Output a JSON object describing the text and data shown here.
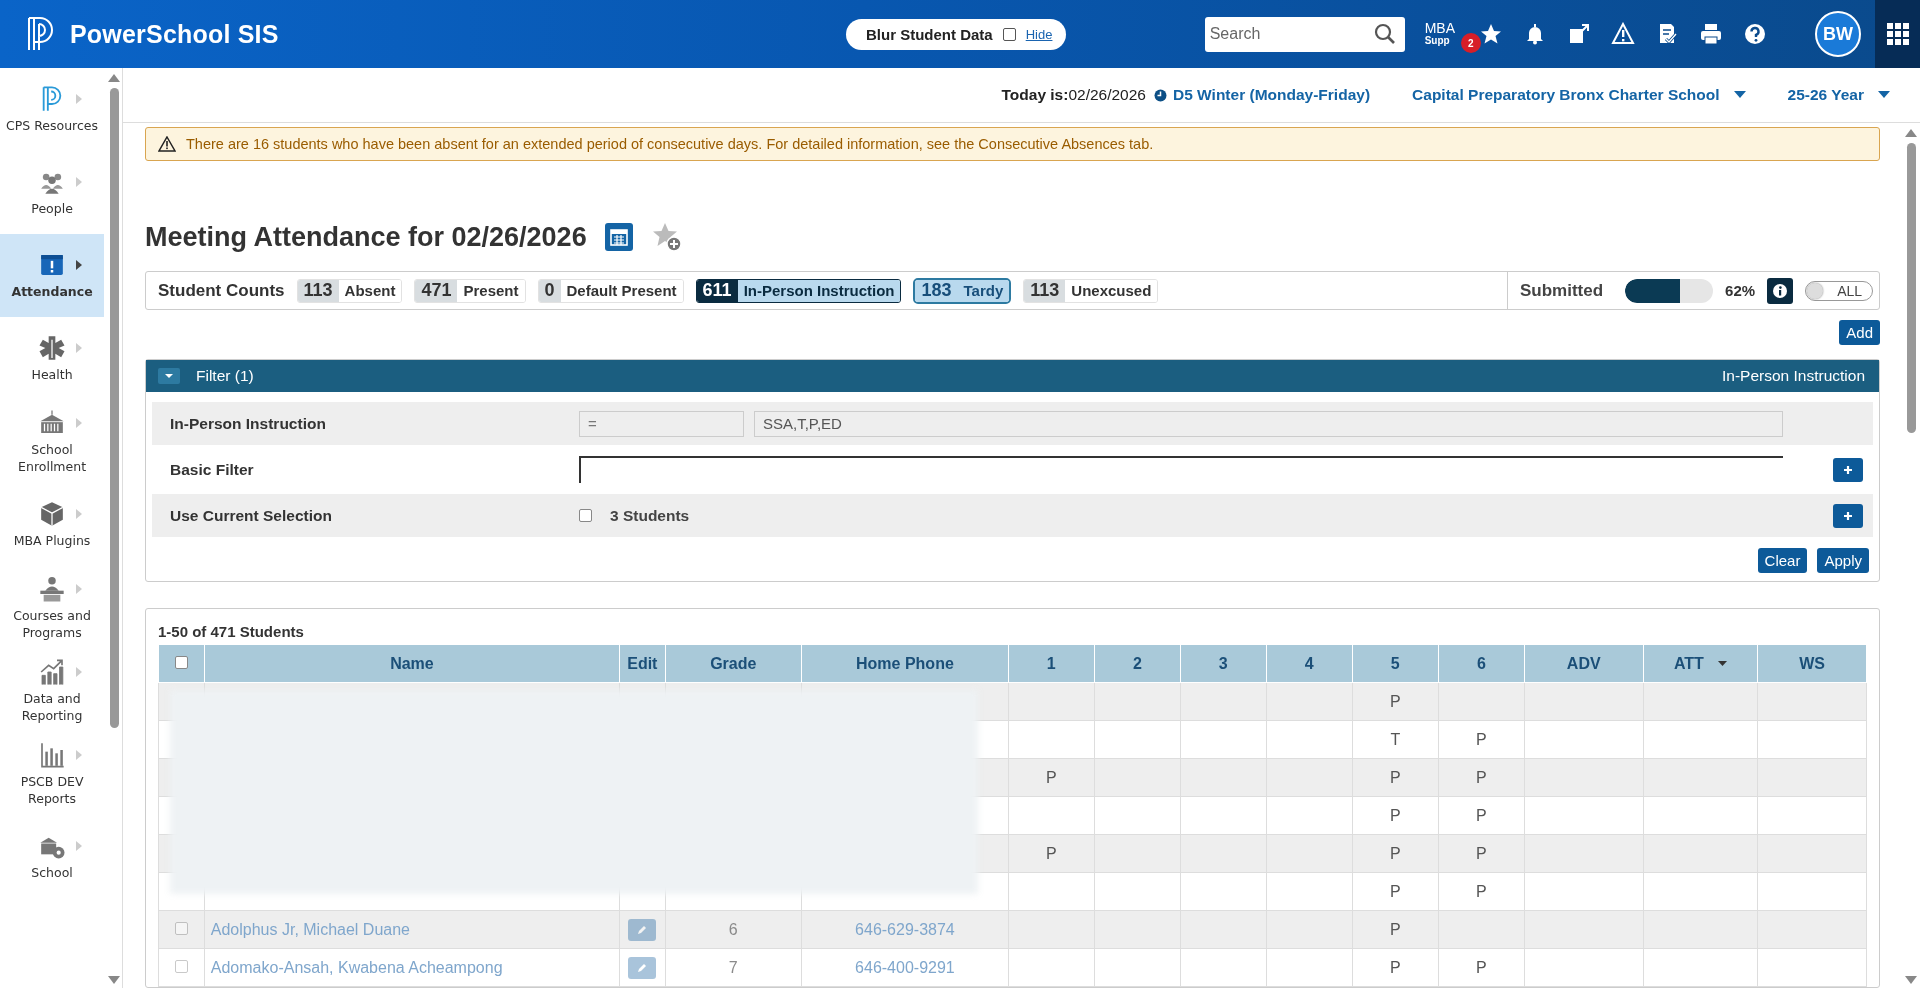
{
  "app": {
    "title": "PowerSchool SIS",
    "blur_label": "Blur Student Data",
    "blur_checked": false,
    "hide_link": "Hide",
    "search_placeholder": "Search",
    "mba_label": "MBA",
    "mba_sub": "Supp",
    "mba_badge": "2",
    "avatar": "BW"
  },
  "sidebar": {
    "items": [
      {
        "label": "CPS Resources",
        "selected": false
      },
      {
        "label": "People",
        "selected": false
      },
      {
        "label": "Attendance",
        "selected": true
      },
      {
        "label": "Health",
        "selected": false
      },
      {
        "label": "School Enrollment",
        "selected": false
      },
      {
        "label": "MBA Plugins",
        "selected": false
      },
      {
        "label": "Courses and Programs",
        "selected": false
      },
      {
        "label": "Data and Reporting",
        "selected": false
      },
      {
        "label": "PSCB DEV Reports",
        "selected": false
      },
      {
        "label": "School",
        "selected": false
      }
    ]
  },
  "info_bar": {
    "today_label": "Today is:",
    "today": "02/26/2026",
    "term": "D5 Winter (Monday-Friday)",
    "school": "Capital Preparatory Bronx Charter School",
    "year": "25-26 Year"
  },
  "alert": "There are 16 students who have been absent for an extended period of consecutive days. For detailed information, see the Consecutive Absences tab.",
  "page_title": "Meeting Attendance for 02/26/2026",
  "counts": {
    "label": "Student Counts",
    "items": [
      {
        "count": "113",
        "label": "Absent",
        "kind": "plain"
      },
      {
        "count": "471",
        "label": "Present",
        "kind": "plain"
      },
      {
        "count": "0",
        "label": "Default Present",
        "kind": "plain"
      },
      {
        "count": "611",
        "label": "In-Person Instruction",
        "kind": "active"
      },
      {
        "count": "183",
        "label": "Tardy",
        "kind": "outlined"
      },
      {
        "count": "113",
        "label": "Unexcused",
        "kind": "plain"
      }
    ],
    "submitted_label": "Submitted",
    "level": 0.62,
    "reading": "62%",
    "toggle_label": "ALL",
    "toggle_on": false
  },
  "add_button": "Add",
  "filter": {
    "title": "Filter (1)",
    "right_label": "In-Person Instruction",
    "expanded": true,
    "rows": [
      {
        "kind": "criteria",
        "label": "In-Person Instruction",
        "operator": "=",
        "value": "SSA,T,P,ED"
      },
      {
        "kind": "text",
        "label": "Basic Filter"
      },
      {
        "kind": "selection",
        "label": "Use Current Selection",
        "checked": false,
        "text": "3 Students"
      }
    ],
    "buttons": [
      "Clear",
      "Apply"
    ]
  },
  "table": {
    "summary": "1-50 of 471 Students",
    "header_checked": false,
    "columns": [
      {
        "label": "Name",
        "sorted": false
      },
      {
        "label": "Edit",
        "sorted": false
      },
      {
        "label": "Grade",
        "sorted": false
      },
      {
        "label": "Home Phone",
        "sorted": false
      },
      {
        "label": "1",
        "sorted": false
      },
      {
        "label": "2",
        "sorted": false
      },
      {
        "label": "3",
        "sorted": false
      },
      {
        "label": "4",
        "sorted": false
      },
      {
        "label": "5",
        "sorted": false
      },
      {
        "label": "6",
        "sorted": false
      },
      {
        "label": "ADV",
        "sorted": false
      },
      {
        "label": "ATT",
        "sorted": true
      },
      {
        "label": "WS",
        "sorted": false
      }
    ],
    "rows": [
      {
        "period_5": "P"
      },
      {
        "period_5": "T",
        "period_6": "P"
      },
      {
        "period_1": "P",
        "period_5": "P",
        "period_6": "P"
      },
      {
        "period_5": "P",
        "period_6": "P"
      },
      {
        "period_1": "P",
        "period_5": "P",
        "period_6": "P"
      },
      {
        "period_5": "P",
        "period_6": "P"
      },
      {
        "checked": false,
        "name": "Adolphus Jr, Michael Duane",
        "grade": "6",
        "phone": "646-629-3874",
        "period_5": "P"
      },
      {
        "checked": false,
        "name": "Adomako-Ansah, Kwabena Acheampong",
        "grade": "7",
        "phone": "646-400-9291",
        "period_5": "P",
        "period_6": "P"
      }
    ]
  }
}
